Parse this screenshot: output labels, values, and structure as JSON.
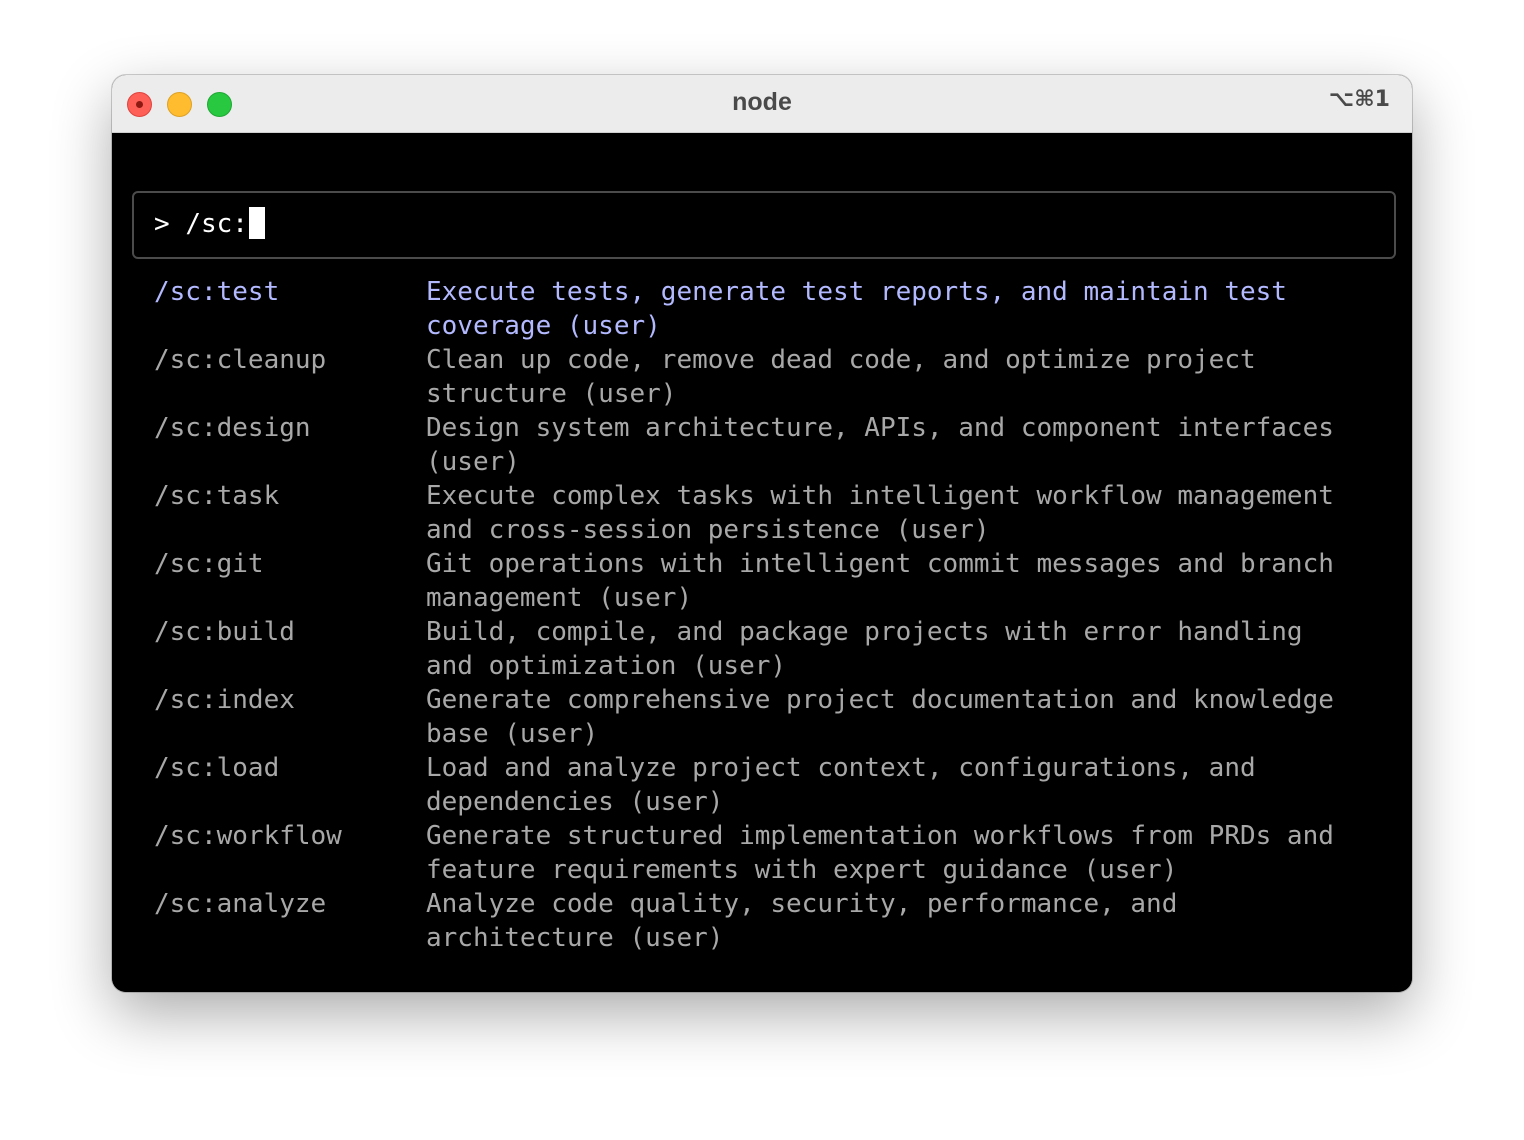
{
  "window": {
    "title": "node",
    "shortcut": "⌥⌘1"
  },
  "input": {
    "prompt_symbol": ">",
    "value": "/sc:"
  },
  "colors": {
    "selected_text": "#b3b9ff",
    "normal_text": "#a8a8a8",
    "background": "#000000"
  },
  "commands": [
    {
      "name": "/sc:test",
      "desc_lines": [
        "Execute tests, generate test reports, and maintain test",
        "coverage (user)"
      ],
      "selected": true
    },
    {
      "name": "/sc:cleanup",
      "desc_lines": [
        "Clean up code, remove dead code, and optimize project",
        "structure (user)"
      ],
      "selected": false
    },
    {
      "name": "/sc:design",
      "desc_lines": [
        "Design system architecture, APIs, and component interfaces",
        "(user)"
      ],
      "selected": false
    },
    {
      "name": "/sc:task",
      "desc_lines": [
        "Execute complex tasks with intelligent workflow management",
        "and cross-session persistence (user)"
      ],
      "selected": false
    },
    {
      "name": "/sc:git",
      "desc_lines": [
        "Git operations with intelligent commit messages and branch",
        "management (user)"
      ],
      "selected": false
    },
    {
      "name": "/sc:build",
      "desc_lines": [
        "Build, compile, and package projects with error handling",
        "and optimization (user)"
      ],
      "selected": false
    },
    {
      "name": "/sc:index",
      "desc_lines": [
        "Generate comprehensive project documentation and knowledge",
        "base (user)"
      ],
      "selected": false
    },
    {
      "name": "/sc:load",
      "desc_lines": [
        "Load and analyze project context, configurations, and",
        "dependencies (user)"
      ],
      "selected": false
    },
    {
      "name": "/sc:workflow",
      "desc_lines": [
        "Generate structured implementation workflows from PRDs and",
        "feature requirements with expert guidance (user)"
      ],
      "selected": false
    },
    {
      "name": "/sc:analyze",
      "desc_lines": [
        "Analyze code quality, security, performance, and",
        "architecture (user)"
      ],
      "selected": false
    }
  ]
}
